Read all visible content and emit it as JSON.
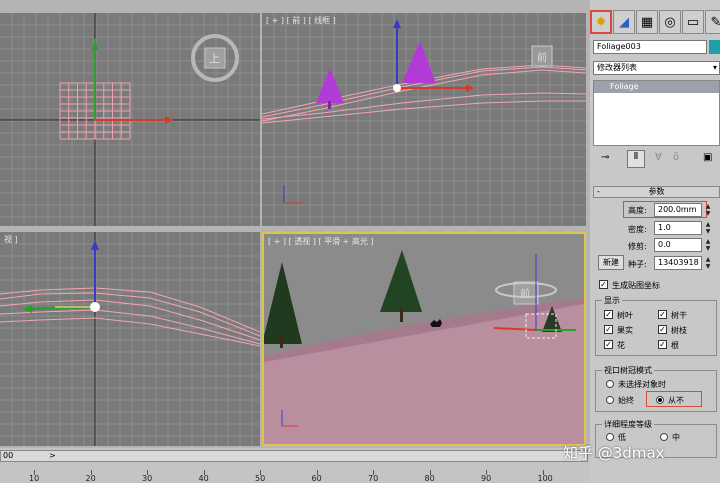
{
  "viewports": {
    "top": {
      "label": ""
    },
    "front": {
      "label": "[ + ] [ 前 ] [ 线框 ]",
      "nav_cube": "前"
    },
    "left": {
      "label": "视 ]"
    },
    "perspective": {
      "label": "[ + ] [ 透视 ] [ 平滑 + 高光 ]"
    },
    "top_nav_cube": "上",
    "persp_nav_cube": "前"
  },
  "axis_labels": {
    "x": "x",
    "y": "y",
    "z": "z"
  },
  "panel": {
    "tabs": [
      "create-icon",
      "modify-icon",
      "hierarchy-icon",
      "motion-icon",
      "display-icon",
      "utilities-icon"
    ],
    "object_name": "Foliage003",
    "modifier_list": "修改器列表",
    "stack_item": "Foliage",
    "rollout_title": "参数",
    "height_label": "高度:",
    "height_value": "200.0mm",
    "density_label": "密度:",
    "density_value": "1.0",
    "prune_label": "修剪:",
    "prune_value": "0.0",
    "new_button": "新建",
    "seed_label": "种子:",
    "seed_value": "13403918",
    "gen_mapping": "生成贴图坐标",
    "display_group": "显示",
    "display_items": {
      "leaves": "树叶",
      "trunk": "树干",
      "fruit": "果实",
      "branches": "树枝",
      "flowers": "花",
      "roots": "根"
    },
    "canopy_group": "视口树冠模式",
    "canopy_when_not_selected": "未选择对象时",
    "canopy_always": "始终",
    "canopy_never": "从不",
    "detail_group": "详细程度等级",
    "detail_low": "低",
    "detail_medium": "中"
  },
  "timeline": {
    "frame_display": "00",
    "nav_arrow": ">",
    "ticks": [
      "10",
      "20",
      "30",
      "40",
      "50",
      "60",
      "70",
      "80",
      "90",
      "100"
    ]
  },
  "watermark": "知乎 @3dmax",
  "colors": {
    "viewport_bg": "#7a7a7a",
    "selection_border": "#e1c24a",
    "tree_magenta": "#b23ad6",
    "terrain_pink": "#b98fa0",
    "grid_pink": "#f4a0b0"
  }
}
